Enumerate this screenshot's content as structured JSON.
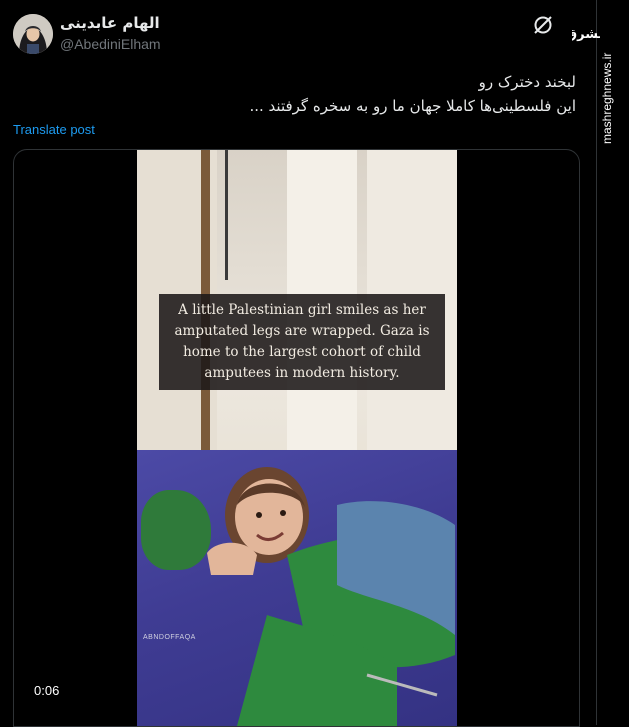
{
  "post": {
    "author_name": "الهام عابدینی",
    "handle": "@AbediniElham",
    "text_line1": "لبخند دخترک رو",
    "text_line2": "این فلسطینی‌ها کاملا جهان ما رو به سخره گرفتند ...",
    "translate_label": "Translate post"
  },
  "video": {
    "caption": "A little Palestinian girl smiles as her amputated legs are wrapped. Gaza is home to the largest cohort of child amputees in modern history.",
    "watermark": "ABNDOFFAQA",
    "timestamp": "0:06"
  },
  "watermark": {
    "logo_text": "مشرق",
    "site": "mashreghnews.ir"
  },
  "icons": {
    "grok": "grok-icon",
    "avatar": "avatar"
  },
  "colors": {
    "background": "#000000",
    "text": "#e7e9ea",
    "muted": "#71767b",
    "link": "#1d9bf0",
    "border": "#2f3336"
  }
}
